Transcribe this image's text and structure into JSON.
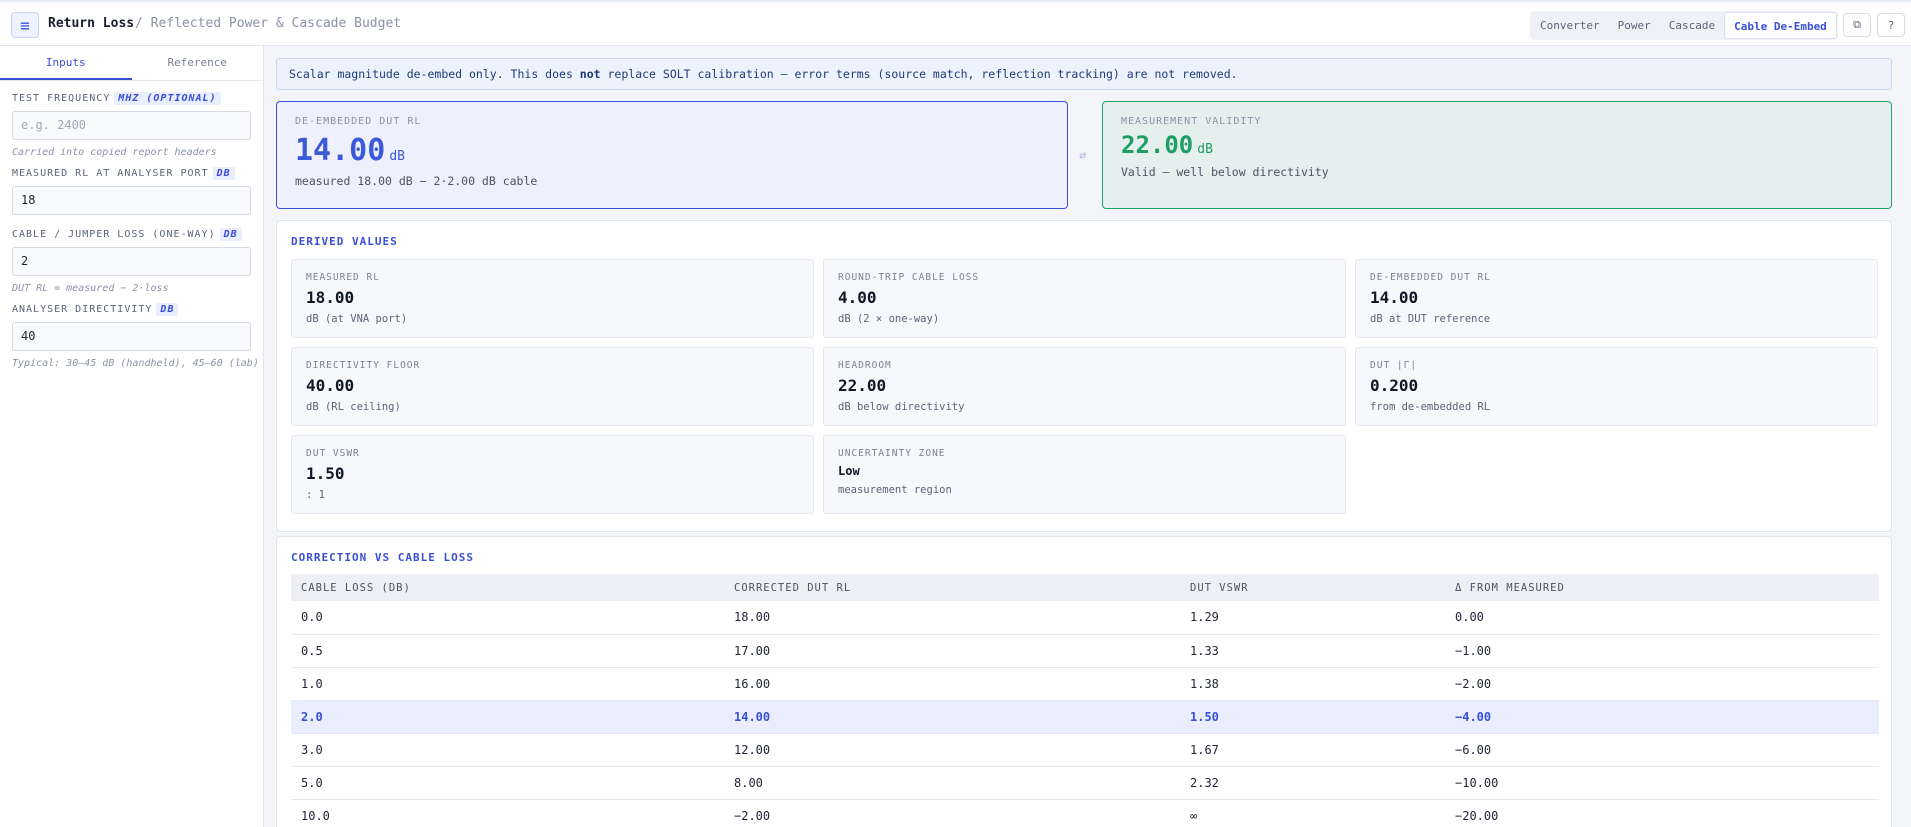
{
  "header": {
    "title": "Return Loss",
    "subtitle": "/ Reflected Power & Cascade Budget",
    "tabs": [
      "Converter",
      "Power",
      "Cascade",
      "Cable De-Embed"
    ]
  },
  "sidebar": {
    "tabs": [
      "Inputs",
      "Reference"
    ],
    "fields": {
      "freq": {
        "label": "TEST FREQUENCY",
        "unit": "MHZ (OPTIONAL)",
        "placeholder": "e.g. 2400",
        "hint": "Carried into copied report headers"
      },
      "measured": {
        "label": "MEASURED RL AT ANALYSER PORT",
        "unit": "DB",
        "value": "18"
      },
      "cable": {
        "label": "CABLE / JUMPER LOSS (ONE-WAY)",
        "unit": "DB",
        "value": "2",
        "hint": "DUT RL = measured − 2·loss"
      },
      "directivity": {
        "label": "ANALYSER DIRECTIVITY",
        "unit": "DB",
        "value": "40",
        "hint": "Typical: 30–45 dB (handheld), 45–60 (lab)"
      }
    }
  },
  "notice": {
    "pre": "Scalar magnitude de-embed only. This does ",
    "bold": "not",
    "post": " replace SOLT calibration — error terms (source match, reflection tracking) are not removed."
  },
  "summary": {
    "dut": {
      "label": "DE-EMBEDDED DUT RL",
      "value": "14.00",
      "unit": "dB",
      "sub": "measured 18.00 dB − 2·2.00 dB cable"
    },
    "validity": {
      "label": "MEASUREMENT VALIDITY",
      "value": "22.00",
      "unit": "dB",
      "sub": "Valid — well below directivity"
    }
  },
  "derived": {
    "title": "DERIVED VALUES",
    "cards": [
      {
        "label": "MEASURED RL",
        "value": "18.00",
        "sub": "dB (at VNA port)"
      },
      {
        "label": "ROUND-TRIP CABLE LOSS",
        "value": "4.00",
        "sub": "dB (2 × one-way)"
      },
      {
        "label": "DE-EMBEDDED DUT RL",
        "value": "14.00",
        "sub": "dB at DUT reference"
      },
      {
        "label": "DIRECTIVITY FLOOR",
        "value": "40.00",
        "sub": "dB (RL ceiling)"
      },
      {
        "label": "HEADROOM",
        "value": "22.00",
        "sub": "dB below directivity"
      },
      {
        "label": "DUT |Γ|",
        "value": "0.200",
        "sub": "from de-embedded RL"
      },
      {
        "label": "DUT VSWR",
        "value": "1.50",
        "sub": ": 1"
      },
      {
        "label": "UNCERTAINTY ZONE",
        "value": "Low",
        "sub": "measurement region"
      }
    ]
  },
  "correction": {
    "title": "CORRECTION VS CABLE LOSS",
    "headers": [
      "CABLE LOSS (DB)",
      "CORRECTED DUT RL",
      "DUT VSWR",
      "Δ FROM MEASURED"
    ],
    "rows": [
      [
        "0.0",
        "18.00",
        "1.29",
        "0.00"
      ],
      [
        "0.5",
        "17.00",
        "1.33",
        "−1.00"
      ],
      [
        "1.0",
        "16.00",
        "1.38",
        "−2.00"
      ],
      [
        "2.0",
        "14.00",
        "1.50",
        "−4.00"
      ],
      [
        "3.0",
        "12.00",
        "1.67",
        "−6.00"
      ],
      [
        "5.0",
        "8.00",
        "2.32",
        "−10.00"
      ],
      [
        "10.0",
        "−2.00",
        "∞",
        "−20.00"
      ]
    ],
    "highlight_row": 3
  }
}
